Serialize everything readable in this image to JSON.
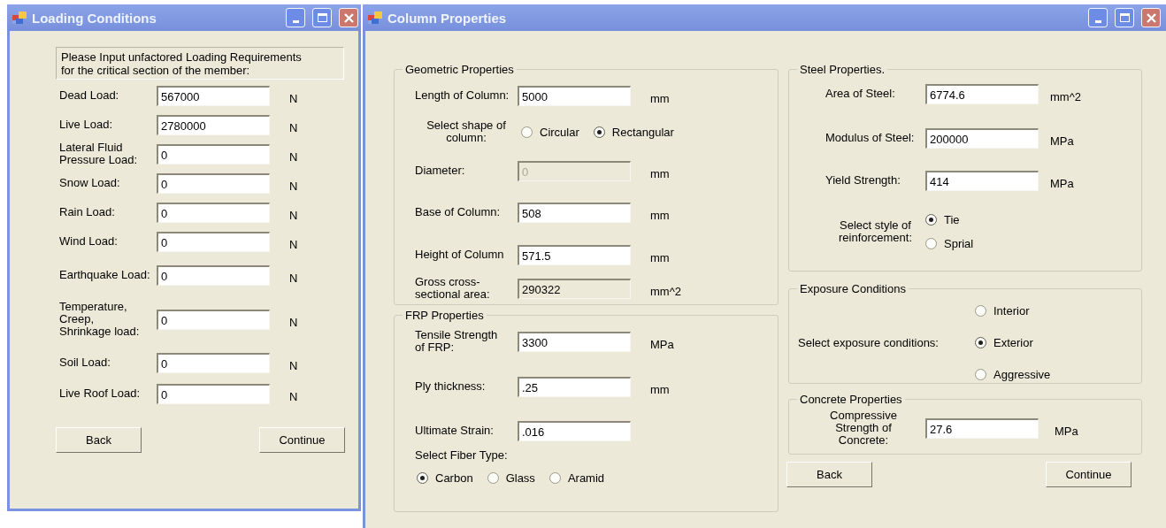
{
  "loading_window": {
    "title": "Loading Conditions",
    "instructions": "Please Input unfactored Loading Requirements\nfor the critical section of the member:",
    "fields": [
      {
        "label": "Dead Load:",
        "value": "567000",
        "unit": "N"
      },
      {
        "label": "Live Load:",
        "value": "2780000",
        "unit": "N"
      },
      {
        "label": "Lateral Fluid\nPressure Load:",
        "value": "0",
        "unit": "N"
      },
      {
        "label": "Snow Load:",
        "value": "0",
        "unit": "N"
      },
      {
        "label": "Rain Load:",
        "value": "0",
        "unit": "N"
      },
      {
        "label": "Wind Load:",
        "value": "0",
        "unit": "N"
      },
      {
        "label": "Earthquake Load:",
        "value": "0",
        "unit": "N"
      },
      {
        "label": "Temperature,\nCreep,\nShrinkage load:",
        "value": "0",
        "unit": "N"
      },
      {
        "label": "Soil Load:",
        "value": "0",
        "unit": "N"
      },
      {
        "label": "Live Roof Load:",
        "value": "0",
        "unit": "N"
      }
    ],
    "buttons": [
      "Back",
      "Continue"
    ]
  },
  "column_window": {
    "title": "Column Properties",
    "columns": [
      {
        "groups": [
          {
            "title": "Geometric Properties",
            "rows": [
              {
                "kind": "field",
                "label": "Length of Column:",
                "value": "5000",
                "unit": "mm",
                "disabled": false,
                "read_only": false
              },
              {
                "kind": "radio-row",
                "label": "Select shape of\ncolumn:",
                "options": [
                  {
                    "label": "Circular",
                    "selected": false
                  },
                  {
                    "label": "Rectangular",
                    "selected": true
                  }
                ]
              },
              {
                "kind": "field",
                "label": "Diameter:",
                "value": "0",
                "unit": "mm",
                "disabled": true,
                "read_only": false
              },
              {
                "kind": "field",
                "label": "Base of Column:",
                "value": "508",
                "unit": "mm",
                "disabled": false,
                "read_only": false
              },
              {
                "kind": "field",
                "label": "Height of Column",
                "value": "571.5",
                "unit": "mm",
                "disabled": false,
                "read_only": false
              },
              {
                "kind": "field",
                "label": "Gross cross-\nsectional area:",
                "value": "290322",
                "unit": "mm^2",
                "disabled": false,
                "read_only": true
              }
            ]
          },
          {
            "title": "FRP Properties",
            "rows": [
              {
                "kind": "field",
                "label": "Tensile Strength\nof FRP:",
                "value": "3300",
                "unit": "MPa",
                "disabled": false,
                "read_only": false
              },
              {
                "kind": "field",
                "label": "Ply thickness:",
                "value": ".25",
                "unit": "mm",
                "disabled": false,
                "read_only": false
              },
              {
                "kind": "field",
                "label": "Ultimate Strain:",
                "value": ".016",
                "unit": "",
                "disabled": false,
                "read_only": false
              },
              {
                "kind": "radio-below",
                "label": "Select Fiber Type:",
                "options": [
                  {
                    "label": "Carbon",
                    "selected": true
                  },
                  {
                    "label": "Glass",
                    "selected": false
                  },
                  {
                    "label": "Aramid",
                    "selected": false
                  }
                ]
              }
            ]
          }
        ]
      },
      {
        "groups": [
          {
            "title": "Steel Properties.",
            "rows": [
              {
                "kind": "field",
                "label": "Area of Steel:",
                "value": "6774.6",
                "unit": "mm^2",
                "disabled": false,
                "read_only": false
              },
              {
                "kind": "field",
                "label": "Modulus of Steel:",
                "value": "200000",
                "unit": "MPa",
                "disabled": false,
                "read_only": false
              },
              {
                "kind": "field",
                "label": "Yield Strength:",
                "value": "414",
                "unit": "MPa",
                "disabled": false,
                "read_only": false
              },
              {
                "kind": "radio-stack",
                "label": "Select style of\nreinforcement:",
                "options": [
                  {
                    "label": "Tie",
                    "selected": true
                  },
                  {
                    "label": "Sprial",
                    "selected": false
                  }
                ]
              }
            ]
          },
          {
            "title": "Exposure Conditions",
            "rows": [
              {
                "kind": "radio-stack",
                "label": "Select exposure conditions:",
                "options": [
                  {
                    "label": "Interior",
                    "selected": false
                  },
                  {
                    "label": "Exterior",
                    "selected": true
                  },
                  {
                    "label": "Aggressive",
                    "selected": false
                  }
                ]
              }
            ]
          },
          {
            "title": "Concrete Properties",
            "rows": [
              {
                "kind": "field",
                "label": "Compressive\nStrength of\nConcrete:",
                "value": "27.6",
                "unit": "MPa",
                "disabled": false,
                "read_only": false
              }
            ]
          }
        ]
      }
    ],
    "buttons": [
      "Back",
      "Continue"
    ]
  }
}
